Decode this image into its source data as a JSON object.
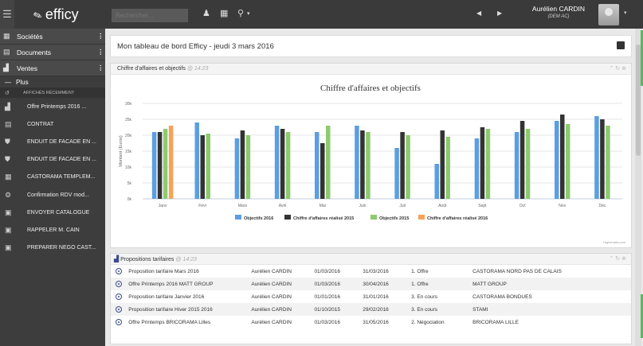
{
  "app": {
    "logo": "efficy",
    "search_placeholder": "Rechercher...",
    "user_name": "Aurélien CARDIN",
    "user_sub": "(DEM AC)"
  },
  "sidebar": {
    "main": [
      {
        "icon": "building-icon",
        "label": "Sociétés"
      },
      {
        "icon": "document-icon",
        "label": "Documents"
      },
      {
        "icon": "chart-icon",
        "label": "Ventes"
      }
    ],
    "plus_label": "Plus",
    "recent_label": "AFFICHÉS RÉCEMMENT",
    "recent_items": [
      {
        "icon": "chart-icon",
        "label": "Offre Printemps 2016 ..."
      },
      {
        "icon": "document-icon",
        "label": "CONTRAT"
      },
      {
        "icon": "cart-icon",
        "label": "ENDUIT DE FACADE EN ..."
      },
      {
        "icon": "cart-icon",
        "label": "ENDUIT DE FACADE EN ..."
      },
      {
        "icon": "building-icon",
        "label": "CASTORAMA TEMPLEM..."
      },
      {
        "icon": "network-icon",
        "label": "Confirmation RDV mod..."
      },
      {
        "icon": "calendar-icon",
        "label": "ENVOYER CATALOGUE"
      },
      {
        "icon": "calendar-icon",
        "label": "RAPPELER M. CAIN"
      },
      {
        "icon": "calendar-icon",
        "label": "PREPARER NEGO CAST..."
      }
    ]
  },
  "page": {
    "title": "Mon tableau de bord Efficy - jeudi 3 mars 2016"
  },
  "chart_card": {
    "title": "Chiffre d'affaires et objectifs",
    "time": "@ 14:23"
  },
  "chart_data": {
    "type": "bar",
    "title": "Chiffre d'affaires et objectifs",
    "xlabel": "",
    "ylabel": "Montant (Euros)",
    "ylim": [
      0,
      30000
    ],
    "yticks": [
      "0k",
      "5k",
      "10k",
      "15k",
      "20k",
      "25k",
      "30k"
    ],
    "categories": [
      "Janv",
      "Févr",
      "Mars",
      "Avril",
      "Mai",
      "Juin",
      "Juil",
      "Août",
      "Sept",
      "Oct",
      "Nov",
      "Déc"
    ],
    "series": [
      {
        "name": "Objectifs 2016",
        "color": "#5b9ee3",
        "values": [
          21000,
          24000,
          19000,
          23000,
          21000,
          23000,
          16000,
          11000,
          19000,
          21000,
          24500,
          26000
        ]
      },
      {
        "name": "Chiffre d'affaires réalisé 2015",
        "color": "#333333",
        "values": [
          21000,
          20000,
          21500,
          22000,
          17500,
          21500,
          21000,
          21500,
          22500,
          24500,
          26500,
          25000
        ]
      },
      {
        "name": "Objectifs 2015",
        "color": "#8ccb6e",
        "values": [
          22000,
          20500,
          20000,
          21000,
          23000,
          21000,
          20000,
          19500,
          22000,
          22000,
          23500,
          23000
        ]
      },
      {
        "name": "Chiffre d'affaires réalisé 2016",
        "color": "#f7a15a",
        "values": [
          23000,
          null,
          null,
          null,
          null,
          null,
          null,
          null,
          null,
          null,
          null,
          null
        ]
      }
    ],
    "legend_position": "bottom",
    "credits": "Highcharts.com",
    "grid": true
  },
  "table_card": {
    "title": "Propositions tarifaires",
    "time": "@ 14:23",
    "rows": [
      [
        "Proposition tarifaire Mars 2016",
        "Aurélien CARDIN",
        "01/03/2016",
        "31/03/2016",
        "1. Offre",
        "CASTORAMA NORD PAS DE CALAIS"
      ],
      [
        "Offre Printemps 2016 MATT GROUP",
        "Aurélien CARDIN",
        "01/03/2016",
        "30/04/2016",
        "1. Offre",
        "MATT GROUP"
      ],
      [
        "Proposition tarifaire Janvier 2016",
        "Aurélien CARDIN",
        "01/01/2016",
        "31/01/2016",
        "3. En cours",
        "CASTORAMA BONDUES"
      ],
      [
        "Proposition tarifaire Hiver 2015 2016",
        "Aurélien CARDIN",
        "01/10/2015",
        "29/02/2016",
        "3. En cours",
        "STAMI"
      ],
      [
        "Offre Printemps BRICORAMA Lilles",
        "Aurélien CARDIN",
        "01/03/2016",
        "31/05/2016",
        "2. Négociation",
        "BRICORAMA LILLE"
      ]
    ]
  }
}
